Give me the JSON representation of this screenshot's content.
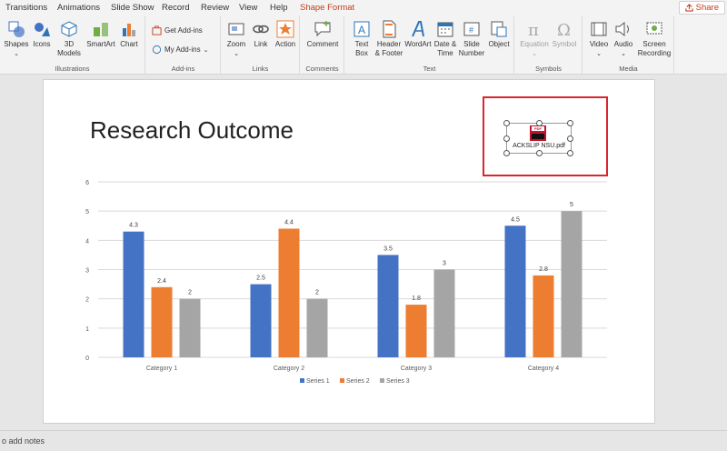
{
  "tabs": [
    "Transitions",
    "Animations",
    "Slide Show",
    "Record",
    "Review",
    "View",
    "Help",
    "Shape Format"
  ],
  "share_label": "Share",
  "ribbon": {
    "illustrations": {
      "label": "Illustrations",
      "buttons": [
        "Shapes",
        "Icons",
        "3D Models",
        "SmartArt",
        "Chart"
      ]
    },
    "addins": {
      "label": "Add-ins",
      "get": "Get Add-ins",
      "my": "My Add-ins"
    },
    "links": {
      "label": "Links",
      "buttons": [
        "Zoom",
        "Link",
        "Action"
      ]
    },
    "comments": {
      "label": "Comments",
      "buttons": [
        "Comment"
      ]
    },
    "text": {
      "label": "Text",
      "buttons": [
        "Text Box",
        "Header & Footer",
        "WordArt",
        "Date & Time",
        "Slide Number",
        "Object"
      ]
    },
    "symbols": {
      "label": "Symbols",
      "buttons": [
        "Equation",
        "Symbol"
      ]
    },
    "media": {
      "label": "Media",
      "buttons": [
        "Video",
        "Audio",
        "Screen Recording"
      ]
    }
  },
  "slide": {
    "title": "Research Outcome",
    "object_filename": "ACKSLIP NSU.pdf",
    "pdf_badge": "PDF"
  },
  "chart_data": {
    "type": "bar",
    "categories": [
      "Category 1",
      "Category 2",
      "Category 3",
      "Category 4"
    ],
    "series": [
      {
        "name": "Series 1",
        "values": [
          4.3,
          2.5,
          3.5,
          4.5
        ],
        "color": "#4472c4"
      },
      {
        "name": "Series 2",
        "values": [
          2.4,
          4.4,
          1.8,
          2.8
        ],
        "color": "#ed7d31"
      },
      {
        "name": "Series 3",
        "values": [
          2,
          2,
          3,
          5
        ],
        "color": "#a5a5a5"
      }
    ],
    "ylim": [
      0,
      6
    ],
    "yticks": [
      0,
      1,
      2,
      3,
      4,
      5,
      6
    ],
    "grid": true,
    "legend": "bottom"
  },
  "status": {
    "notes": "o add notes"
  }
}
